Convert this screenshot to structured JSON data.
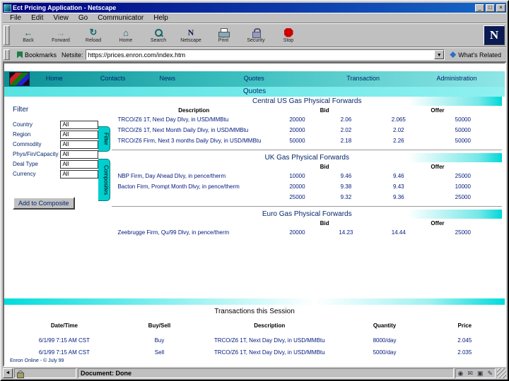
{
  "window": {
    "title": "Ect Pricing Application - Netscape",
    "menu": [
      "File",
      "Edit",
      "View",
      "Go",
      "Communicator",
      "Help"
    ],
    "toolbar": [
      "Back",
      "Forward",
      "Reload",
      "Home",
      "Search",
      "Netscape",
      "Print",
      "Security",
      "Stop"
    ],
    "location": {
      "bookmarks_label": "Bookmarks",
      "field_label": "Netsite:",
      "url": "https://prices.enron.com/index.htm",
      "whats_related_label": "What's Related"
    },
    "status_text": "Document: Done"
  },
  "page": {
    "nav": {
      "items": [
        "Home",
        "Contacts",
        "News",
        "Quotes",
        "Transaction",
        "Administration"
      ]
    },
    "title": "Quotes",
    "filter": {
      "heading": "Filter",
      "fields": [
        {
          "label": "Country",
          "value": "All"
        },
        {
          "label": "Region",
          "value": "All"
        },
        {
          "label": "Commodity",
          "value": "All"
        },
        {
          "label": "Phys/Fin/Capacity",
          "value": "All"
        },
        {
          "label": "Deal Type",
          "value": "All"
        },
        {
          "label": "Currency",
          "value": "All"
        }
      ],
      "add_button": "Add to Composite",
      "side_tabs": [
        "Filter",
        "Composites"
      ]
    },
    "quotes": {
      "columns": {
        "description": "Description",
        "bid": "Bid",
        "offer": "Offer"
      },
      "sections": [
        {
          "title": "Central US Gas Physical Forwards",
          "rows": [
            {
              "description": "TRCO/Z6 1T, Next Day Dlvy, in USD/MMBtu",
              "bid_qty": "20000",
              "bid": "2.06",
              "offer": "2.065",
              "offer_qty": "50000"
            },
            {
              "description": "TRCO/Z6 1T, Next Month Daily Dlvy, in USD/MMBtu",
              "bid_qty": "20000",
              "bid": "2.02",
              "offer": "2.02",
              "offer_qty": "50000"
            },
            {
              "description": "TRCO/Z6 Firm, Next 3 months Daily Dlvy, in USD/MMBtu",
              "bid_qty": "50000",
              "bid": "2.18",
              "offer": "2.26",
              "offer_qty": "50000"
            }
          ]
        },
        {
          "title": "UK Gas Physical Forwards",
          "rows": [
            {
              "description": "NBP Firm, Day Ahead Dlvy, in pence/therm",
              "bid_qty": "10000",
              "bid": "9.46",
              "offer": "9.46",
              "offer_qty": "25000"
            },
            {
              "description": "Bacton Firm, Prompt Month Dlvy, in pence/therm",
              "bid_qty": "20000",
              "bid": "9.38",
              "offer": "9.43",
              "offer_qty": "10000"
            },
            {
              "description": "",
              "bid_qty": "25000",
              "bid": "9.32",
              "offer": "9.36",
              "offer_qty": "25000"
            }
          ]
        },
        {
          "title": "Euro Gas Physical Forwards",
          "rows": [
            {
              "description": "Zeebrugge Firm, Qu/99 Dlvy, in pence/therm",
              "bid_qty": "20000",
              "bid": "14.23",
              "offer": "14.44",
              "offer_qty": "25000"
            }
          ]
        }
      ]
    },
    "transactions": {
      "title": "Transactions this Session",
      "columns": [
        "Date/Time",
        "Buy/Sell",
        "Description",
        "Quantity",
        "Price"
      ],
      "rows": [
        {
          "datetime": "6/1/99 7:15 AM CST",
          "buysell": "Buy",
          "description": "TRCO/Z6 1T, Next Day Dlvy, in USD/MMBtu",
          "quantity": "8000/day",
          "price": "2.045"
        },
        {
          "datetime": "6/1/99 7:15 AM CST",
          "buysell": "Sell",
          "description": "TRCO/Z6 1T, Next Day Dlvy, in USD/MMBtu",
          "quantity": "5000/day",
          "price": "2.035"
        }
      ]
    },
    "footer": "Enron Online - © July 99"
  },
  "colors": {
    "teal_accent": "#00cccc",
    "navy_text": "#00197d",
    "titlebar_blue": "#000080"
  }
}
